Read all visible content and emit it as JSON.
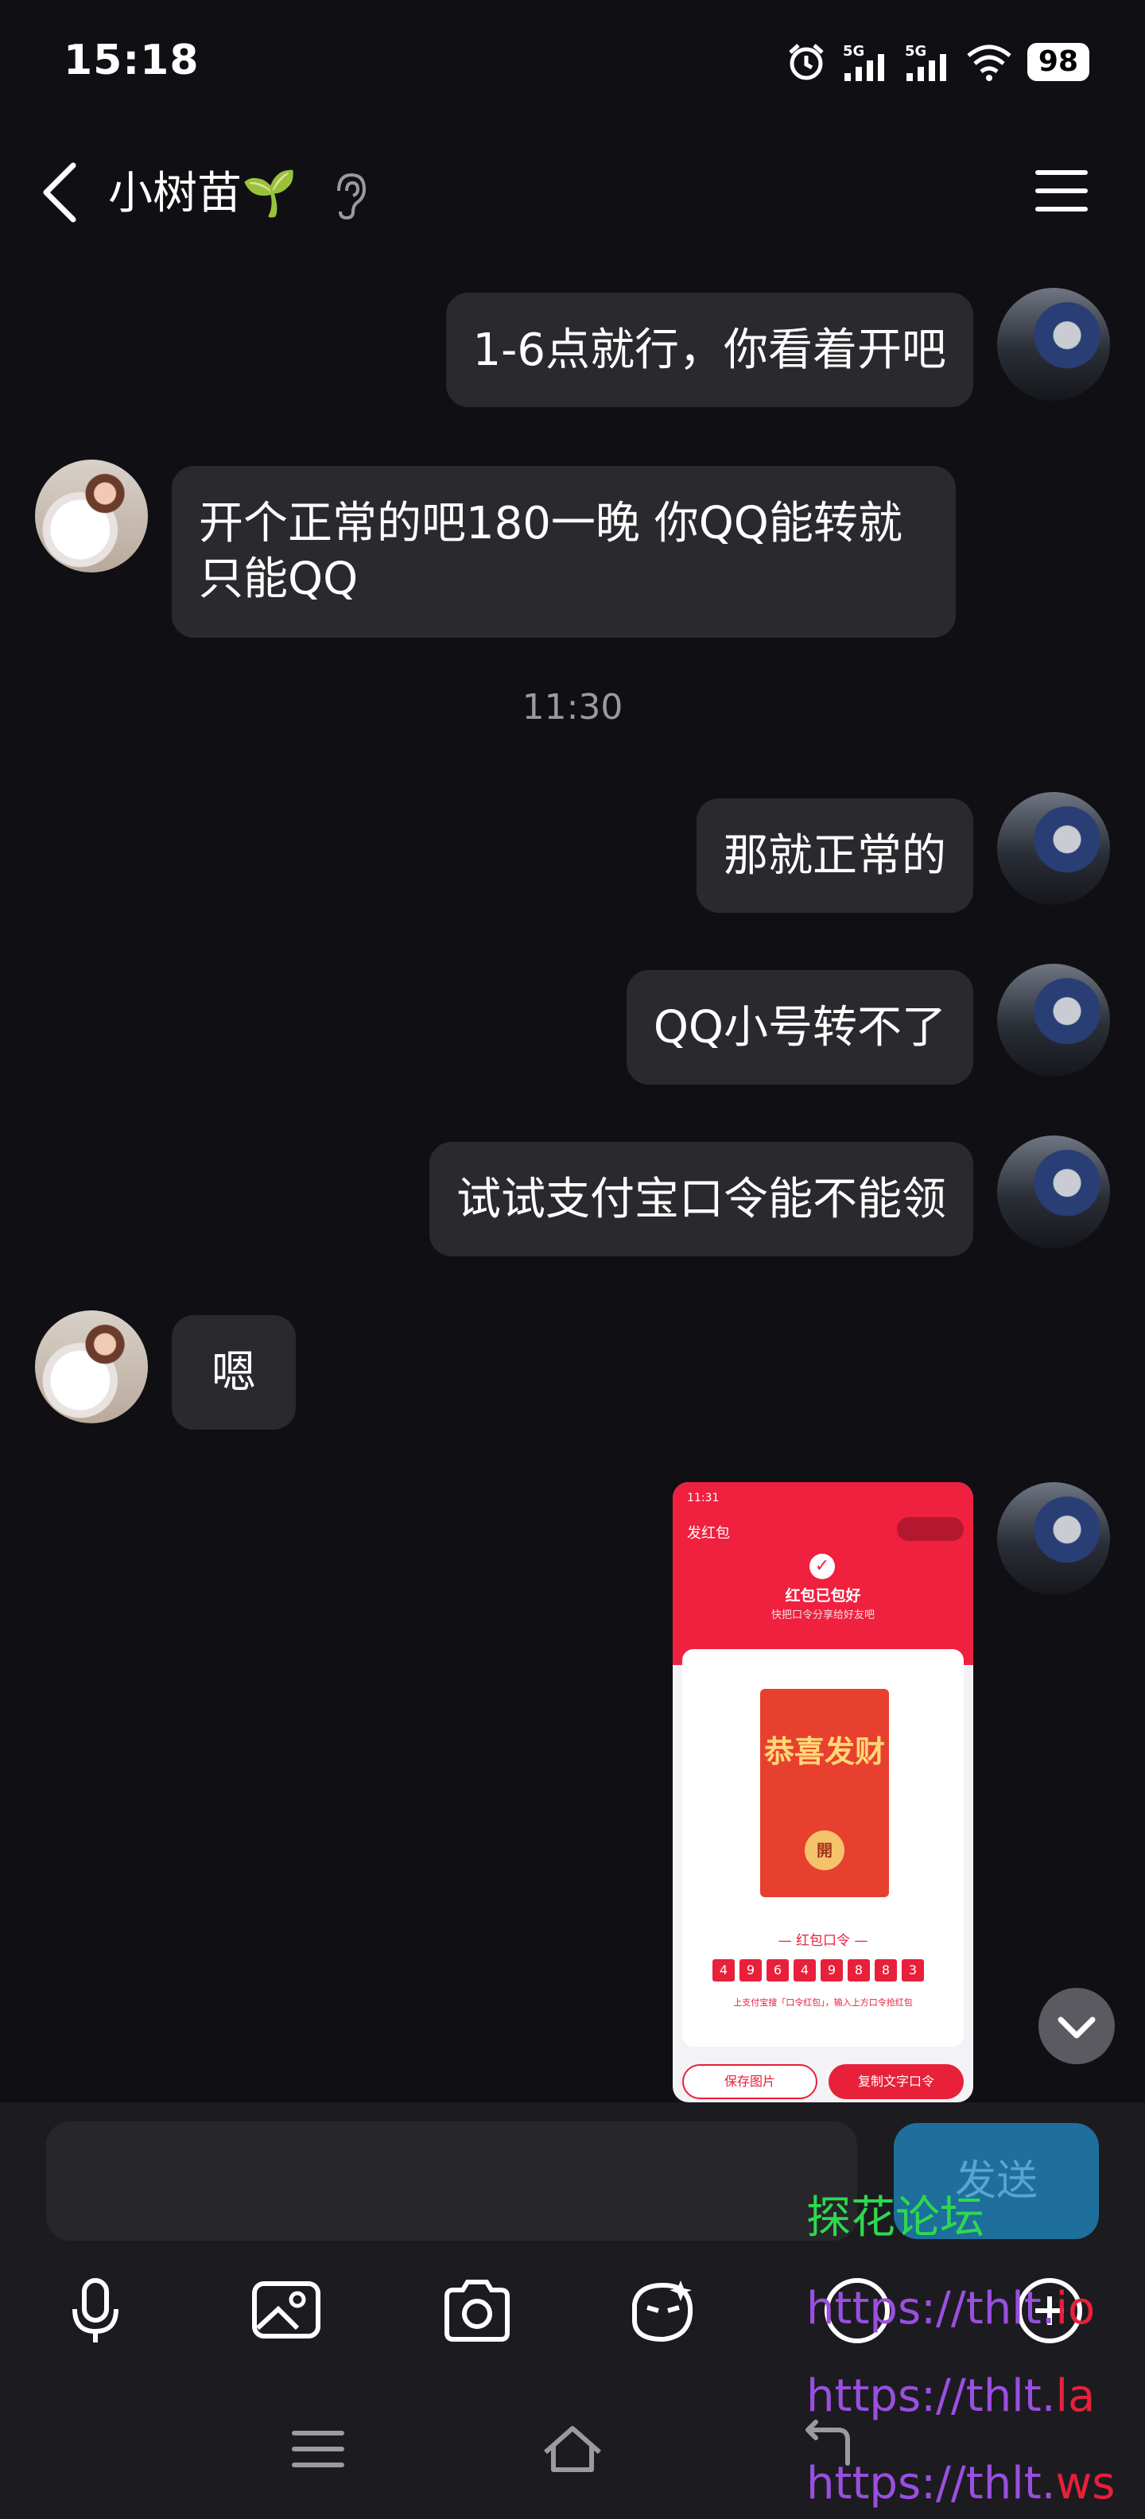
{
  "status": {
    "time": "15:18",
    "network1": "5G",
    "network2": "5G",
    "battery": "98"
  },
  "header": {
    "title": "小树苗🌱"
  },
  "messages": [
    {
      "side": "right",
      "text": "1-6点就行，你看着开吧"
    },
    {
      "side": "left",
      "text": "开个正常的吧180一晚  你QQ能转就只能QQ"
    },
    {
      "side": "right",
      "text": "那就正常的"
    },
    {
      "side": "right",
      "text": "QQ小号转不了"
    },
    {
      "side": "right",
      "text": "试试支付宝口令能不能领"
    },
    {
      "side": "left",
      "text": "嗯"
    }
  ],
  "timestamp": "11:30",
  "shared_screenshot": {
    "time": "11:31",
    "back_label": "发红包",
    "title": "红包已包好",
    "subtitle": "快把口令分享给好友吧",
    "envelope_text": "恭喜发财",
    "open_char": "開",
    "code_label": "— 红包口令 —",
    "code_digits": [
      "4",
      "9",
      "6",
      "4",
      "9",
      "8",
      "8",
      "3"
    ],
    "hint": "上支付宝搜「口令红包」，输入上方口令抢红包",
    "save_button": "保存图片",
    "copy_button": "复制文字口令"
  },
  "composer": {
    "send_label": "发送"
  },
  "watermark": {
    "line1": "探花论坛",
    "line2_a": "https://thlt.",
    "line2_b": "io",
    "line3_a": "https://thlt.",
    "line3_b": "la",
    "line4_a": "https://thlt.",
    "line4_b": "ws"
  },
  "icons": [
    "microphone-icon",
    "image-icon",
    "camera-icon",
    "sticker-icon",
    "emoji-icon",
    "plus-icon",
    "menu-icon",
    "home-icon",
    "back-icon"
  ]
}
